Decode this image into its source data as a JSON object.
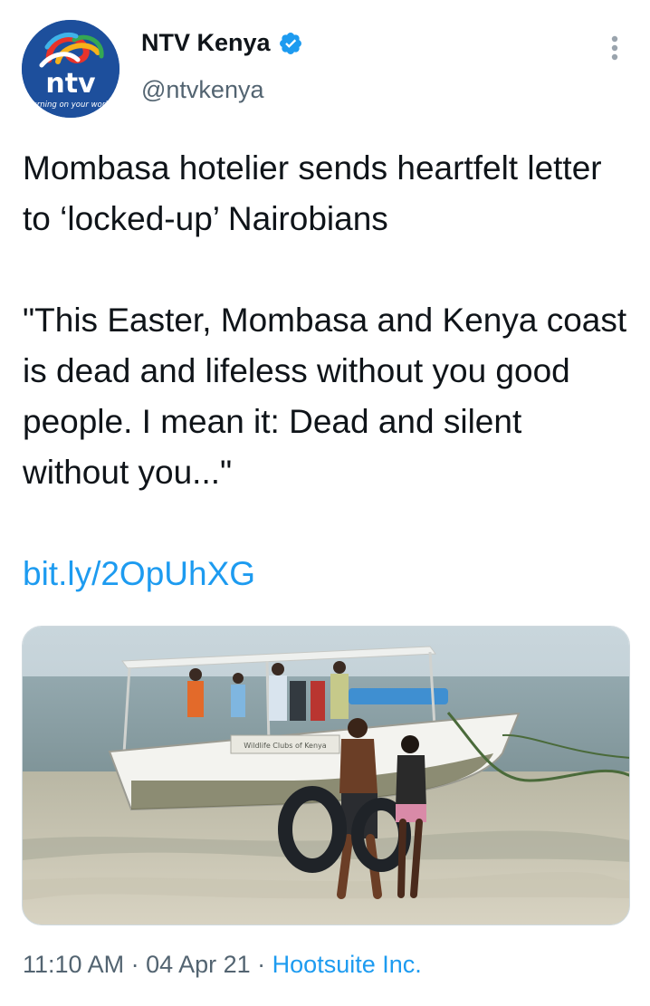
{
  "author": {
    "name": "NTV Kenya",
    "handle": "@ntvkenya",
    "avatar_logo": "ntv",
    "avatar_tagline": "turning on your world",
    "verified": true
  },
  "tweet": {
    "headline": "Mombasa hotelier sends heartfelt letter to ‘locked-up’ Nairobians",
    "quote": "\"This Easter, Mombasa and Kenya coast is dead and lifeless without you good people. I mean it: Dead and silent without you...\"",
    "link": "bit.ly/2OpUhXG"
  },
  "media": {
    "boat_name": "Wildlife Clubs of Kenya"
  },
  "meta": {
    "time": "11:10 AM",
    "separator1": " · ",
    "date": "04 Apr 21",
    "separator2": " · ",
    "source": "Hootsuite Inc."
  },
  "colors": {
    "link": "#1d9bf0",
    "secondary_text": "#536471",
    "primary_text": "#0f1419",
    "verified_badge": "#1d9bf0",
    "avatar_bg": "#1d4f9c"
  },
  "icons": {
    "verified": "verified-badge-icon",
    "more": "more-vertical-icon"
  }
}
